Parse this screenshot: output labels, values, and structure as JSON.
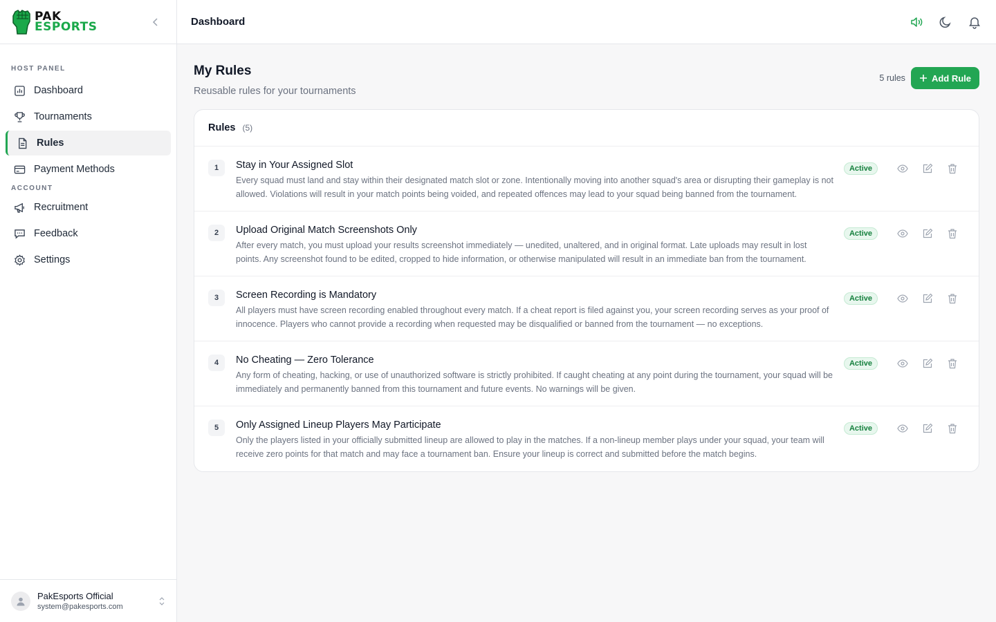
{
  "brand": {
    "line1": "PAK",
    "line2": "ESPORTS"
  },
  "sidebar": {
    "section1_label": "HOST PANEL",
    "section1_items": [
      {
        "label": "Dashboard",
        "icon": "bar-chart-icon"
      },
      {
        "label": "Tournaments",
        "icon": "trophy-icon"
      },
      {
        "label": "Rules",
        "icon": "document-icon",
        "active": true
      },
      {
        "label": "Payment Methods",
        "icon": "credit-card-icon"
      }
    ],
    "section2_label": "ACCOUNT",
    "section2_items": [
      {
        "label": "Recruitment",
        "icon": "megaphone-icon"
      },
      {
        "label": "Feedback",
        "icon": "message-icon"
      },
      {
        "label": "Settings",
        "icon": "gear-icon"
      }
    ]
  },
  "user": {
    "name": "PakEsports Official",
    "email": "system@pakesports.com"
  },
  "topbar": {
    "title": "Dashboard"
  },
  "page": {
    "title": "My Rules",
    "subtitle": "Reusable rules for your tournaments",
    "count_text": "5 rules",
    "add_button": "Add Rule"
  },
  "card": {
    "title": "Rules",
    "count": "(5)"
  },
  "rules": [
    {
      "num": "1",
      "title": "Stay in Your Assigned Slot",
      "desc": "Every squad must land and stay within their designated match slot or zone. Intentionally moving into another squad's area or disrupting their gameplay is not allowed. Violations will result in your match points being voided, and repeated offences may lead to your squad being banned from the tournament.",
      "status": "Active"
    },
    {
      "num": "2",
      "title": "Upload Original Match Screenshots Only",
      "desc": "After every match, you must upload your results screenshot immediately — unedited, unaltered, and in original format. Late uploads may result in lost points. Any screenshot found to be edited, cropped to hide information, or otherwise manipulated will result in an immediate ban from the tournament.",
      "status": "Active"
    },
    {
      "num": "3",
      "title": "Screen Recording is Mandatory",
      "desc": "All players must have screen recording enabled throughout every match. If a cheat report is filed against you, your screen recording serves as your proof of innocence. Players who cannot provide a recording when requested may be disqualified or banned from the tournament — no exceptions.",
      "status": "Active"
    },
    {
      "num": "4",
      "title": "No Cheating — Zero Tolerance",
      "desc": "Any form of cheating, hacking, or use of unauthorized software is strictly prohibited. If caught cheating at any point during the tournament, your squad will be immediately and permanently banned from this tournament and future events. No warnings will be given.",
      "status": "Active"
    },
    {
      "num": "5",
      "title": "Only Assigned Lineup Players May Participate",
      "desc": "Only the players listed in your officially submitted lineup are allowed to play in the matches. If a non-lineup member plays under your squad, your team will receive zero points for that match and may face a tournament ban. Ensure your lineup is correct and submitted before the match begins.",
      "status": "Active"
    }
  ],
  "colors": {
    "accent": "#22a653",
    "badge_bg": "#e8f7ee",
    "badge_text": "#15803d"
  }
}
